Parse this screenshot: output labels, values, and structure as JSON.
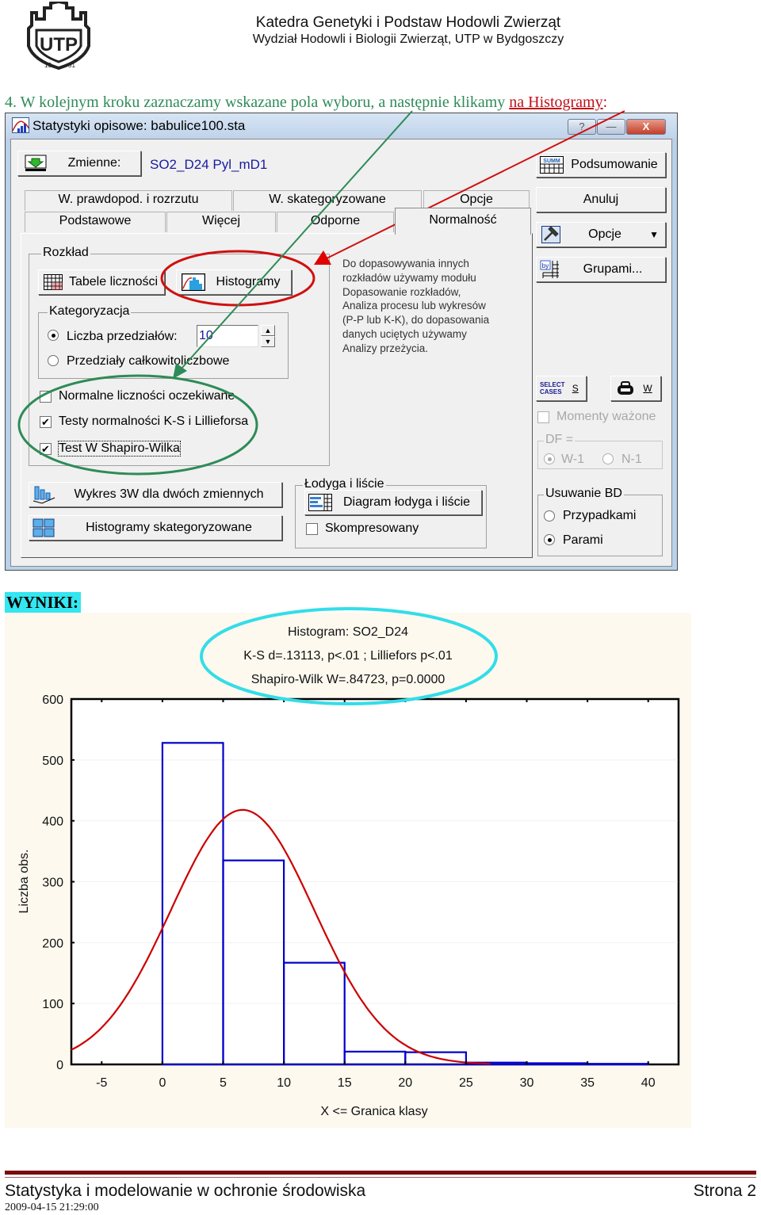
{
  "header": {
    "line1": "Katedra Genetyki i Podstaw Hodowli Zwierząt",
    "line2": "Wydział Hodowli i Biologii Zwierząt, UTP w Bydgoszczy",
    "logo_text": "UTP",
    "logo_year_left": "19",
    "logo_year_right": "51"
  },
  "instruction": {
    "text": "4.  W kolejnym kroku zaznaczamy wskazane pola wyboru, a następnie klikamy ",
    "highlight": "na Histogramy",
    "end": ":"
  },
  "window": {
    "title": "Statystyki opisowe: babulice100.sta",
    "caption_buttons": {
      "help": "?",
      "minimize": "—",
      "close": "X"
    },
    "variables_button": "Zmienne:",
    "variables_value": "SO2_D24 Pyl_mD1",
    "tabs_row1": [
      "W. prawdopod. i rozrzutu",
      "W. skategoryzowane",
      "Opcje"
    ],
    "tabs_row2": [
      "Podstawowe",
      "Więcej",
      "Odporne",
      "Normalność"
    ],
    "active_tab": "Normalność",
    "rozklad": {
      "label": "Rozkład",
      "tabele_button": "Tabele liczności",
      "histogramy_button": "Histogramy"
    },
    "kategoryzacja": {
      "label": "Kategoryzacja",
      "radio_liczba": "Liczba przedziałów:",
      "radio_liczba_selected": true,
      "liczba_value": "10",
      "radio_calkowite": "Przedziały całkowitoliczbowe",
      "radio_calkowite_selected": false
    },
    "checkboxes": [
      {
        "label": "Normalne liczności oczekiwane",
        "checked": false
      },
      {
        "label": "Testy normalności  K-S i Lillieforsa",
        "checked": true
      },
      {
        "label": "Test W Shapiro-Wilka",
        "checked": true
      }
    ],
    "note": [
      "Do dopasowywania innych",
      "rozkładów używamy modułu",
      "Dopasowanie rozkładów,",
      "Analiza procesu lub wykresów",
      "(P-P lub K-K), do dopasowania",
      "danych uciętych używamy",
      "Analizy przeżycia."
    ],
    "wykres3w_button": "Wykres 3W  dla dwóch zmiennych",
    "hist_skat_button": "Histogramy skategoryzowane",
    "lodyga": {
      "label": "Łodyga i liście",
      "diagram_button": "Diagram łodyga i liście",
      "skompresowany_label": "Skompresowany",
      "skompresowany_checked": false
    },
    "side": {
      "podsumowanie_button": "Podsumowanie",
      "anuluj_button": "Anuluj",
      "opcje_button": "Opcje",
      "grupami_button": "Grupami...",
      "select_cases_line1": "SELECT",
      "select_cases_line2": "CASES",
      "select_cases_key": "S",
      "weight_key": "W",
      "momenty_label": "Momenty ważone",
      "df_label": "DF =",
      "df_w1": "W-1",
      "df_n1": "N-1",
      "usuwanie_label": "Usuwanie BD",
      "przypadkami": "Przypadkami",
      "parami": "Parami",
      "usuwanie_selected": "Parami"
    },
    "icon_labels": {
      "summary_icon_text": "SUMM",
      "by_icon_text": "by"
    }
  },
  "results": {
    "heading": "WYNIKI:"
  },
  "chart_data": {
    "type": "bar",
    "title": "Histogram: SO2_D24",
    "subtitle_lines": [
      "K-S d=.13113, p<.01 ; Lilliefors p<.01",
      "Shapiro-Wilk W=.84723, p=0.0000"
    ],
    "xlabel": "X <= Granica klasy",
    "ylabel": "Liczba obs.",
    "xlim": [
      -7.5,
      42.5
    ],
    "ylim": [
      0,
      600
    ],
    "x_ticks": [
      -5,
      0,
      5,
      10,
      15,
      20,
      25,
      30,
      35,
      40
    ],
    "y_ticks": [
      0,
      100,
      200,
      300,
      400,
      500,
      600
    ],
    "bins": [
      {
        "from": 0,
        "to": 5,
        "count": 528
      },
      {
        "from": 5,
        "to": 10,
        "count": 335
      },
      {
        "from": 10,
        "to": 15,
        "count": 167
      },
      {
        "from": 15,
        "to": 20,
        "count": 21
      },
      {
        "from": 20,
        "to": 25,
        "count": 20
      },
      {
        "from": 25,
        "to": 30,
        "count": 3
      },
      {
        "from": 30,
        "to": 35,
        "count": 2
      },
      {
        "from": 35,
        "to": 40,
        "count": 1
      }
    ],
    "normal_fit": {
      "mean": 6.6,
      "peak": 418,
      "sd": 5.9
    },
    "grid": true,
    "colors": {
      "bars": "#0000cc",
      "curve": "#cc0000",
      "background": "#fdf9ef"
    }
  },
  "footer": {
    "course": "Statystyka i modelowanie w ochronie środowiska",
    "page": "Strona 2",
    "date": "2009-04-15 21:29:00"
  }
}
